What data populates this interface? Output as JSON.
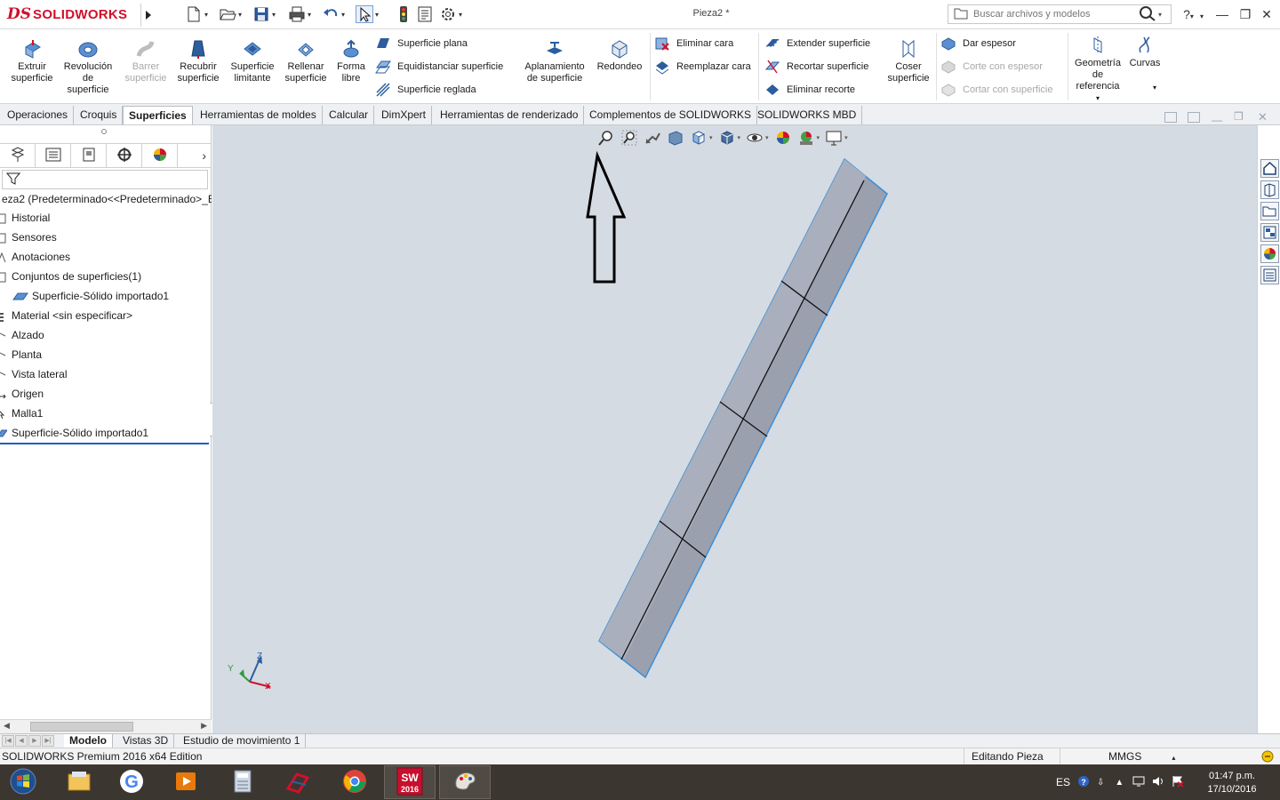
{
  "app": {
    "logo_ds": "DS",
    "logo_text": "SOLIDWORKS",
    "doc_title": "Pieza2 *",
    "search_placeholder": "Buscar archivos y modelos",
    "help_label": "?"
  },
  "colors": {
    "accent_blue": "#1b5fbf",
    "brand_red": "#d0112b",
    "viewport_bg": "#d5dbe3",
    "part_fill": "#9aa0ae",
    "part_edge": "#3b8fd6"
  },
  "command_manager": {
    "big_buttons": [
      {
        "label_lines": [
          "Extruir",
          "superficie"
        ],
        "icon": "extrude-surface-icon",
        "enabled": true
      },
      {
        "label_lines": [
          "Revolución",
          "de",
          "superficie"
        ],
        "icon": "revolve-surface-icon",
        "enabled": true
      },
      {
        "label_lines": [
          "Barrer",
          "superficie"
        ],
        "icon": "sweep-surface-icon",
        "enabled": false
      },
      {
        "label_lines": [
          "Recubrir",
          "superficie"
        ],
        "icon": "loft-surface-icon",
        "enabled": true
      },
      {
        "label_lines": [
          "Superficie",
          "limitante"
        ],
        "icon": "boundary-surface-icon",
        "enabled": true
      },
      {
        "label_lines": [
          "Rellenar",
          "superficie"
        ],
        "icon": "fill-surface-icon",
        "enabled": true
      },
      {
        "label_lines": [
          "Forma",
          "libre"
        ],
        "icon": "freeform-icon",
        "enabled": true
      }
    ],
    "group1": [
      {
        "label": "Superficie plana",
        "icon": "planar-surface-icon",
        "enabled": true
      },
      {
        "label": "Equidistanciar superficie",
        "icon": "offset-surface-icon",
        "enabled": true
      },
      {
        "label": "Superficie reglada",
        "icon": "ruled-surface-icon",
        "enabled": true
      }
    ],
    "mid_buttons": [
      {
        "label_lines": [
          "Aplanamiento",
          "de superficie"
        ],
        "icon": "surface-flatten-icon",
        "enabled": true
      },
      {
        "label_lines": [
          "Redondeo"
        ],
        "icon": "fillet-icon",
        "enabled": true
      }
    ],
    "group2": [
      {
        "label": "Eliminar cara",
        "icon": "delete-face-icon",
        "enabled": true
      },
      {
        "label": "Reemplazar cara",
        "icon": "replace-face-icon",
        "enabled": true
      }
    ],
    "group3": [
      {
        "label": "Extender superficie",
        "icon": "extend-surface-icon",
        "enabled": true
      },
      {
        "label": "Recortar superficie",
        "icon": "trim-surface-icon",
        "enabled": true
      },
      {
        "label": "Eliminar recorte",
        "icon": "untrim-surface-icon",
        "enabled": true
      }
    ],
    "knit_button": {
      "label_lines": [
        "Coser",
        "superficie"
      ],
      "icon": "knit-surface-icon",
      "enabled": true
    },
    "group4": [
      {
        "label": "Dar espesor",
        "icon": "thicken-icon",
        "enabled": true
      },
      {
        "label": "Corte con espesor",
        "icon": "thickened-cut-icon",
        "enabled": false
      },
      {
        "label": "Cortar con superficie",
        "icon": "cut-with-surface-icon",
        "enabled": false
      }
    ],
    "ref_geometry": {
      "label_lines": [
        "Geometría",
        "de",
        "referencia"
      ],
      "icon": "reference-geometry-icon"
    },
    "curves": {
      "label_lines": [
        "Curvas"
      ],
      "icon": "curves-icon"
    }
  },
  "tabs": [
    {
      "label": "Operaciones",
      "active": false
    },
    {
      "label": "Croquis",
      "active": false
    },
    {
      "label": "Superficies",
      "active": true
    },
    {
      "label": "Herramientas de moldes",
      "active": false
    },
    {
      "label": "Calcular",
      "active": false
    },
    {
      "label": "DimXpert",
      "active": false
    },
    {
      "label": "Herramientas de renderizado",
      "active": false
    },
    {
      "label": "Complementos de SOLIDWORKS",
      "active": false
    },
    {
      "label": "SOLIDWORKS MBD",
      "active": false
    }
  ],
  "feature_tree": {
    "root": "eza2  (Predeterminado<<Predeterminado>_E",
    "items": [
      {
        "label": "Historial",
        "icon": "history-icon",
        "indent": false
      },
      {
        "label": "Sensores",
        "icon": "sensors-icon",
        "indent": false
      },
      {
        "label": "Anotaciones",
        "icon": "annotations-icon",
        "indent": false
      },
      {
        "label": "Conjuntos de superficies(1)",
        "icon": "surface-bodies-icon",
        "indent": false
      },
      {
        "label": "Superficie-Sólido importado1",
        "icon": "surface-body-icon",
        "indent": true
      },
      {
        "label": "Material <sin especificar>",
        "icon": "material-icon",
        "indent": false
      },
      {
        "label": "Alzado",
        "icon": "plane-icon",
        "indent": false
      },
      {
        "label": "Planta",
        "icon": "plane-icon",
        "indent": false
      },
      {
        "label": "Vista lateral",
        "icon": "plane-icon",
        "indent": false
      },
      {
        "label": "Origen",
        "icon": "origin-icon",
        "indent": false
      },
      {
        "label": "Malla1",
        "icon": "mesh-icon",
        "indent": false
      },
      {
        "label": "Superficie-Sólido importado1",
        "icon": "imported-surface-icon",
        "indent": false
      }
    ]
  },
  "triad": {
    "x": "X",
    "y": "Y",
    "z": "Z"
  },
  "bottom_tabs": [
    {
      "label": "Modelo",
      "active": true
    },
    {
      "label": "Vistas 3D",
      "active": false
    },
    {
      "label": "Estudio de movimiento 1",
      "active": false
    }
  ],
  "status": {
    "edition": "SOLIDWORKS Premium 2016 x64 Edition",
    "mode": "Editando Pieza",
    "units": "MMGS"
  },
  "taskbar": {
    "apps": [
      {
        "name": "file-explorer-icon"
      },
      {
        "name": "google-icon"
      },
      {
        "name": "media-player-icon"
      },
      {
        "name": "calculator-icon"
      },
      {
        "name": "red-app-icon"
      },
      {
        "name": "chrome-icon"
      },
      {
        "name": "solidworks-2016-icon",
        "label": "2016"
      },
      {
        "name": "paint-icon"
      }
    ],
    "lang": "ES",
    "time": "01:47 p.m.",
    "date": "17/10/2016"
  }
}
